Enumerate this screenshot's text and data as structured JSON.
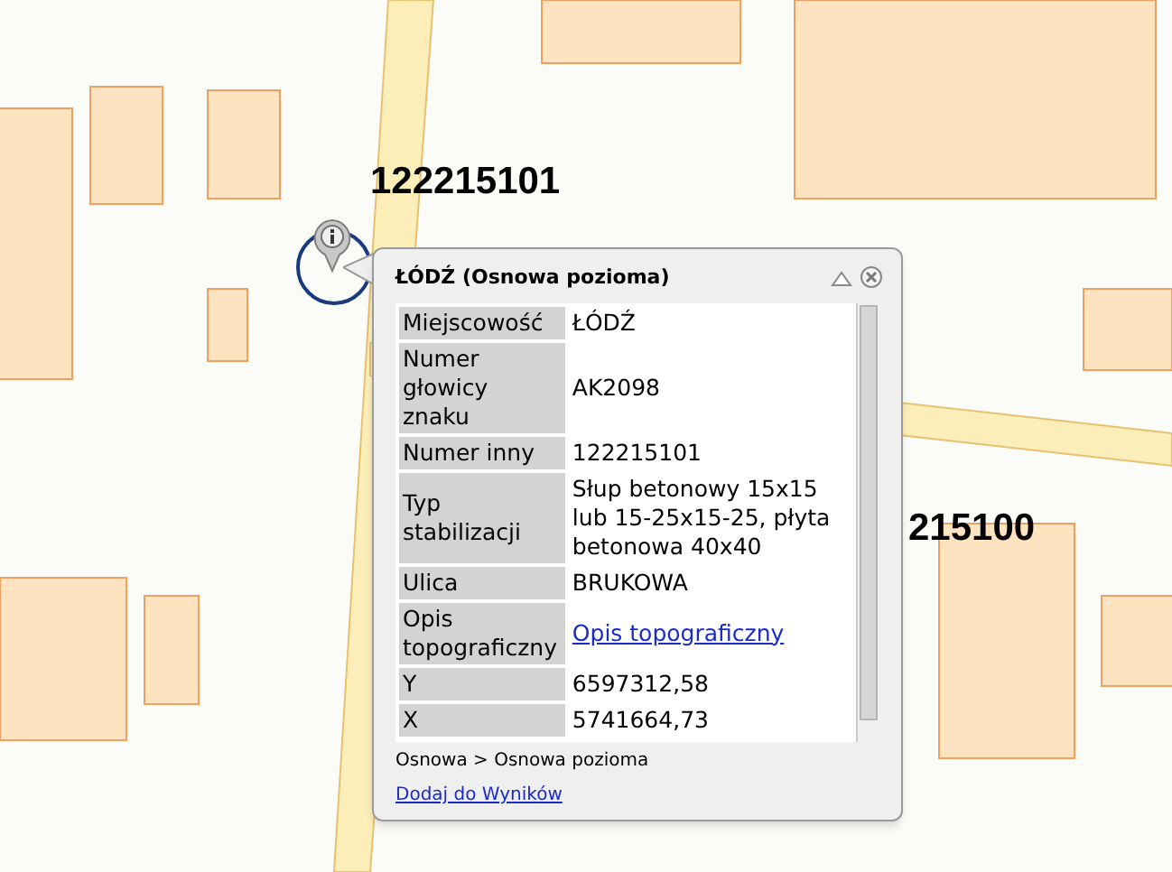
{
  "map": {
    "kind": "picture",
    "labels": [
      {
        "text": "122215101"
      },
      {
        "text": "215100"
      }
    ]
  },
  "popup": {
    "title": "ŁÓDŹ (Osnowa pozioma)",
    "rows": [
      {
        "label": "Miejscowość",
        "value": "ŁÓDŹ",
        "kind": "text"
      },
      {
        "label": "Numer głowicy znaku",
        "value": "AK2098",
        "kind": "text"
      },
      {
        "label": "Numer inny",
        "value": "122215101",
        "kind": "text"
      },
      {
        "label": "Typ stabilizacji",
        "value": "Słup betonowy 15x15 lub 15-25x15-25, płyta betonowa 40x40",
        "kind": "text"
      },
      {
        "label": "Ulica",
        "value": "BRUKOWA",
        "kind": "text"
      },
      {
        "label": "Opis topograficzny",
        "value": "Opis topograficzny",
        "kind": "link"
      },
      {
        "label": "Y",
        "value": "6597312,58",
        "kind": "text"
      },
      {
        "label": "X",
        "value": "5741664,73",
        "kind": "text"
      }
    ],
    "breadcrumb": "Osnowa > Osnowa pozioma",
    "action_link": "Dodaj do Wyników"
  }
}
